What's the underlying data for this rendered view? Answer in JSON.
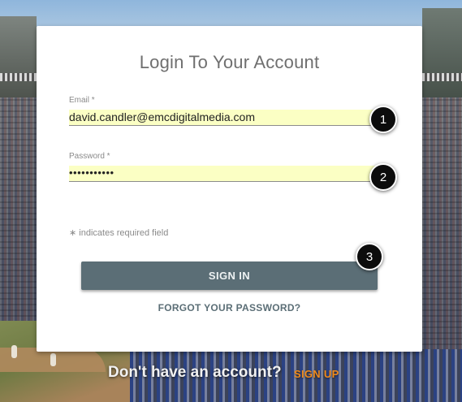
{
  "login": {
    "title": "Login To Your Account",
    "email_label": "Email *",
    "email_value": "david.candler@emcdigitalmedia.com",
    "password_label": "Password *",
    "password_value": "•••••••••••",
    "required_note": "∗ indicates required field",
    "signin_label": "SIGN IN",
    "forgot_label": "FORGOT YOUR PASSWORD?"
  },
  "steps": [
    "1",
    "2",
    "3"
  ],
  "footer": {
    "no_account_text": "Don't have an account?",
    "signup_label": "SIGN UP"
  },
  "colors": {
    "accent": "#5b6e76",
    "signup": "#f08a1c",
    "autofill": "#fbffc4"
  }
}
